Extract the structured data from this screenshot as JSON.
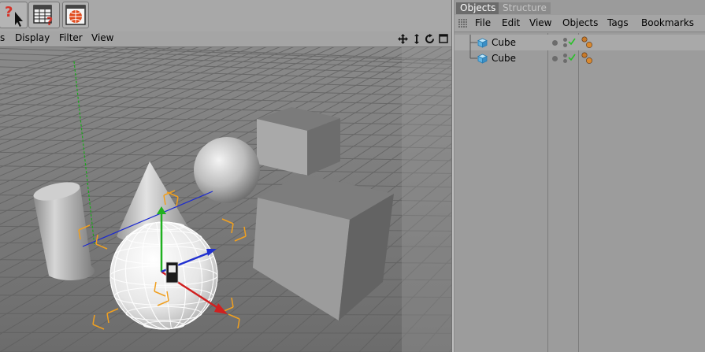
{
  "toolbar": {
    "buttons": [
      {
        "name": "help-pointer-icon"
      },
      {
        "name": "render-settings-icon"
      },
      {
        "name": "render-view-icon"
      }
    ]
  },
  "viewport": {
    "menus": [
      "s",
      "Display",
      "Filter",
      "View"
    ],
    "nav_icons": [
      "move-view-icon",
      "dolly-view-icon",
      "rotate-view-icon",
      "maximize-view-icon"
    ]
  },
  "object_manager": {
    "tabs": [
      {
        "label": "Objects",
        "active": true
      },
      {
        "label": "Structure",
        "active": false
      }
    ],
    "menus": [
      "File",
      "Edit",
      "View",
      "Objects",
      "Tags",
      "Bookmarks"
    ],
    "objects": [
      {
        "name": "Cube",
        "icon": "cube-object-icon",
        "tag": "material-tag-icon",
        "selected": true
      },
      {
        "name": "Cube",
        "icon": "cube-object-icon",
        "tag": "material-tag-icon",
        "selected": false
      }
    ]
  },
  "colors": {
    "tab_active": "#6b6b6b",
    "tab_inactive": "#8b8b8b",
    "viewport_bg": "#767676",
    "axis_x": "#d02020",
    "axis_y": "#20b020",
    "axis_z": "#2030d0",
    "selection_bracket": "#f0a020"
  }
}
